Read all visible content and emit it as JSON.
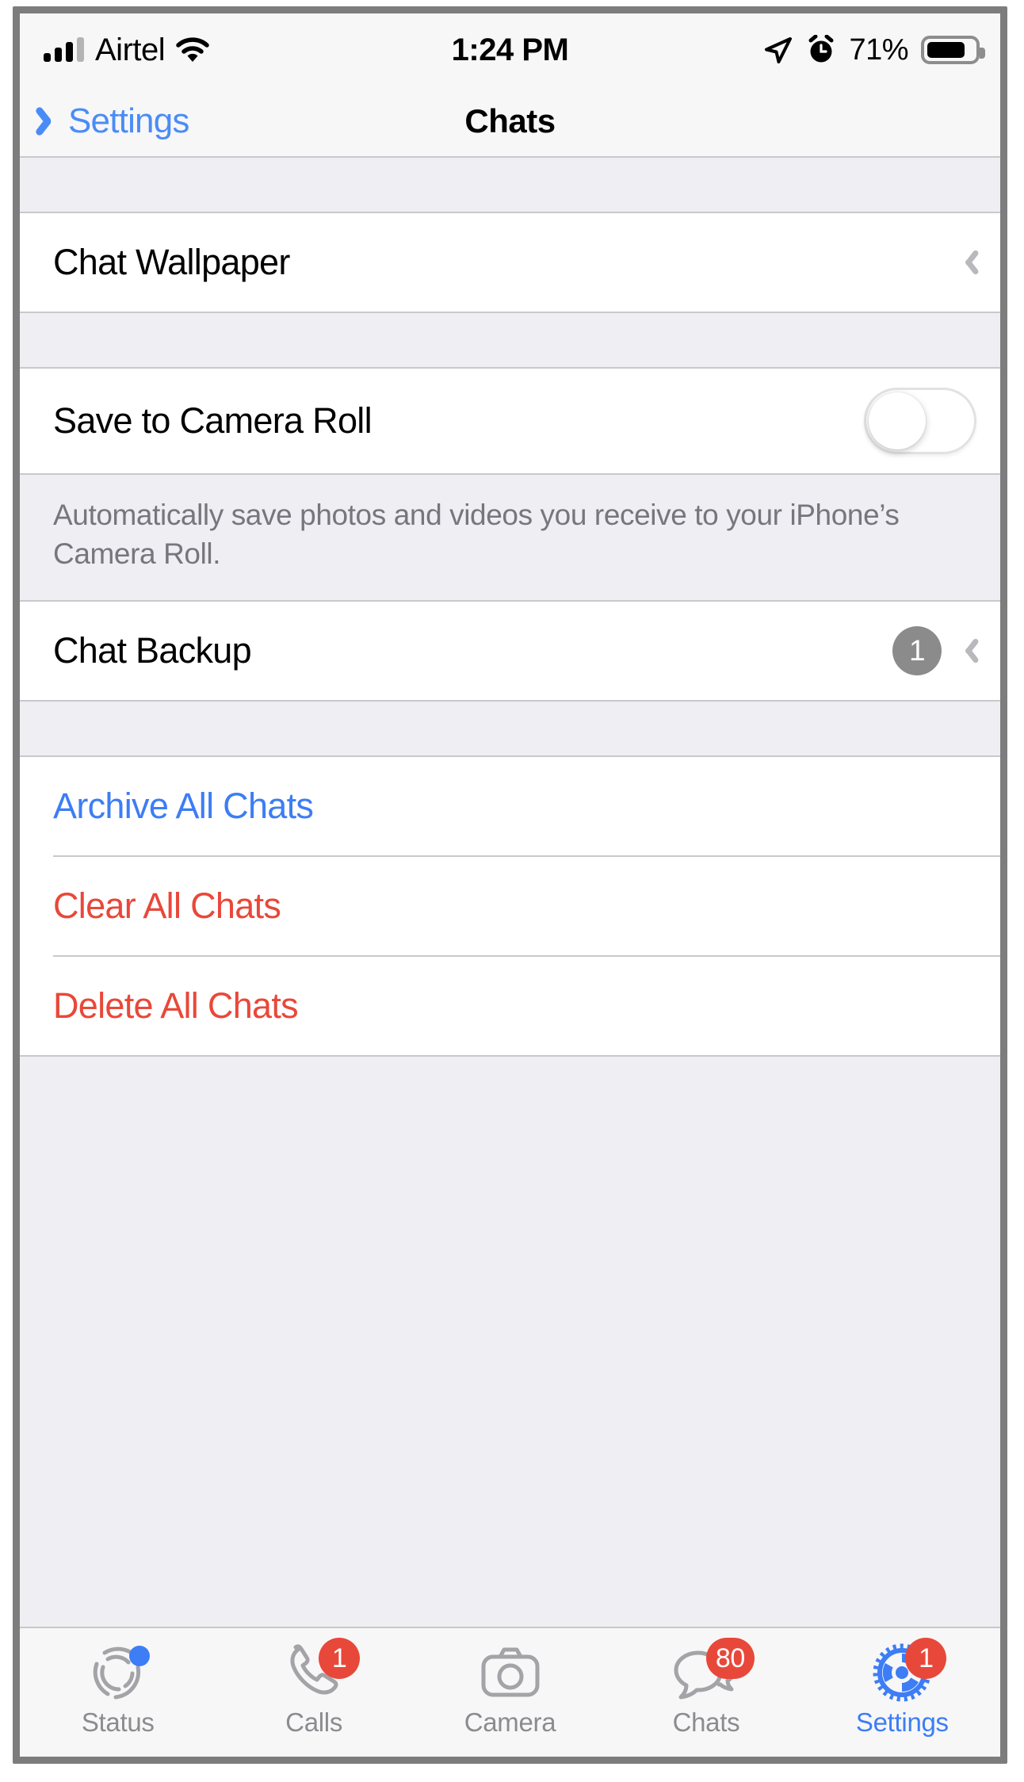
{
  "status_bar": {
    "carrier": "Airtel",
    "signal_icon": "signal-bars-icon",
    "wifi_icon": "wifi-icon",
    "time": "1:24 PM",
    "location_icon": "location-arrow-icon",
    "alarm_icon": "alarm-clock-icon",
    "battery_percent": "71%",
    "battery_icon": "battery-icon"
  },
  "nav_bar": {
    "back_label": "Settings",
    "back_icon": "chevron-left-icon",
    "title": "Chats"
  },
  "sections": {
    "wallpaper": {
      "label": "Chat Wallpaper",
      "disclosure_icon": "chevron-right-icon"
    },
    "camera_roll": {
      "label": "Save to Camera Roll",
      "toggle_state": "off",
      "footer": "Automatically save photos and videos you receive to your iPhone’s Camera Roll."
    },
    "backup": {
      "label": "Chat Backup",
      "badge": "1",
      "disclosure_icon": "chevron-right-icon"
    },
    "actions": [
      {
        "label": "Archive All Chats",
        "style": "blue"
      },
      {
        "label": "Clear All Chats",
        "style": "red"
      },
      {
        "label": "Delete All Chats",
        "style": "red"
      }
    ]
  },
  "tab_bar": {
    "items": [
      {
        "label": "Status",
        "icon": "status-rings-icon",
        "badge": "",
        "badge_type": "dot",
        "active": false
      },
      {
        "label": "Calls",
        "icon": "phone-icon",
        "badge": "1",
        "badge_type": "num",
        "active": false
      },
      {
        "label": "Camera",
        "icon": "camera-icon",
        "badge": "",
        "badge_type": "none",
        "active": false
      },
      {
        "label": "Chats",
        "icon": "chat-bubbles-icon",
        "badge": "80",
        "badge_type": "num",
        "active": false
      },
      {
        "label": "Settings",
        "icon": "gear-icon",
        "badge": "1",
        "badge_type": "num",
        "active": true
      }
    ]
  },
  "colors": {
    "accent_blue": "#3d7df5",
    "destructive_red": "#e8483a",
    "badge_grey": "#8b8b8b",
    "group_background": "#eeeef3",
    "chrome_background": "#f7f7f7"
  }
}
